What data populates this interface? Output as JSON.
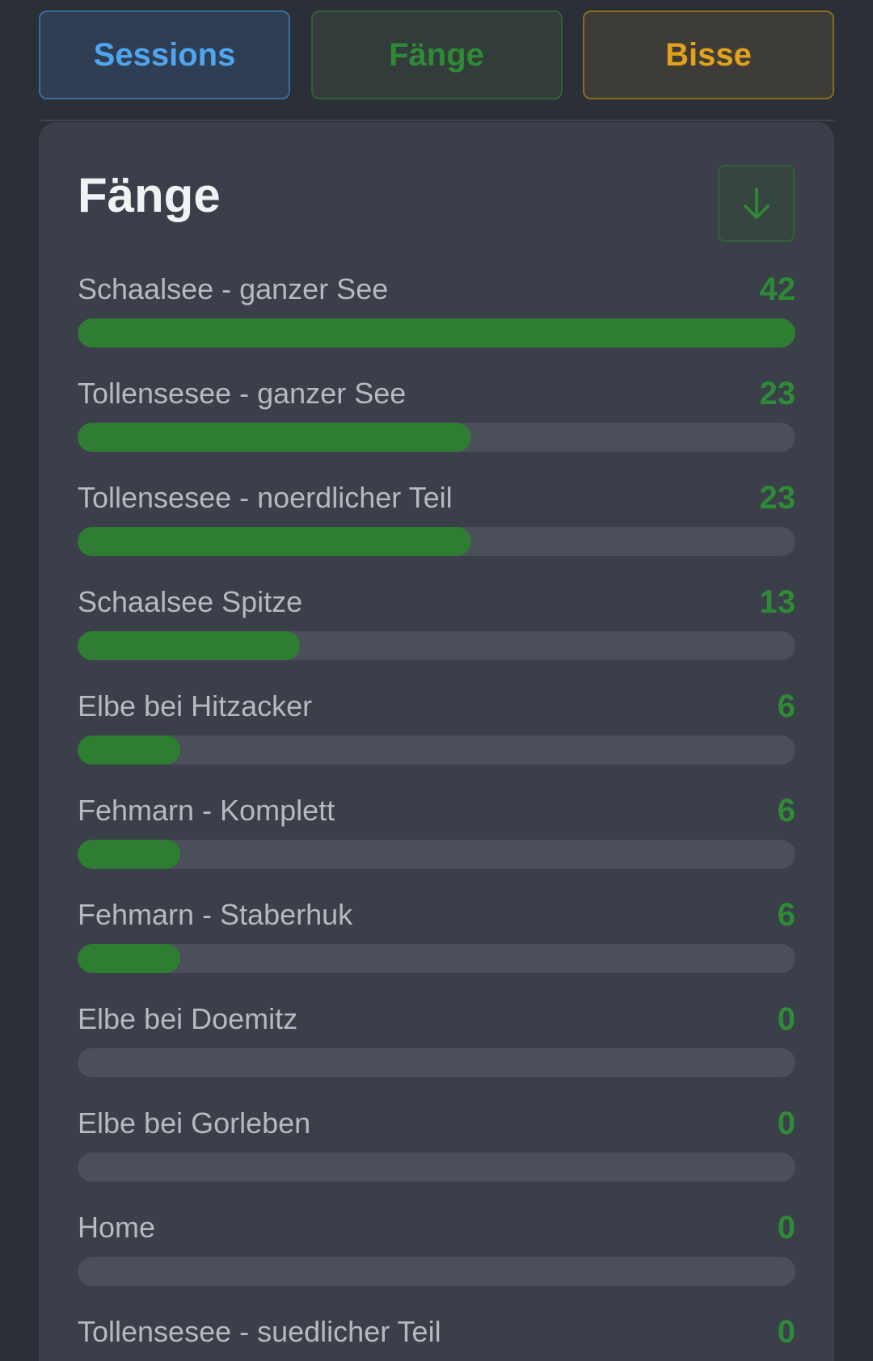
{
  "tabs": [
    {
      "label": "Sessions"
    },
    {
      "label": "Fänge"
    },
    {
      "label": "Bisse"
    }
  ],
  "card": {
    "title": "Fänge",
    "download_icon": "arrow-down-icon"
  },
  "colors": {
    "accent_green": "#2e8b35",
    "sessions_blue": "#4ea6f0",
    "bisse_yellow": "#e2a21b"
  },
  "rows": [
    {
      "label": "Schaalsee - ganzer See",
      "count": 42,
      "fraction": 1.0
    },
    {
      "label": "Tollensesee - ganzer See",
      "count": 23,
      "fraction": 0.548
    },
    {
      "label": "Tollensesee - noerdlicher Teil",
      "count": 23,
      "fraction": 0.548
    },
    {
      "label": "Schaalsee Spitze",
      "count": 13,
      "fraction": 0.31
    },
    {
      "label": "Elbe bei Hitzacker",
      "count": 6,
      "fraction": 0.143
    },
    {
      "label": "Fehmarn - Komplett",
      "count": 6,
      "fraction": 0.143
    },
    {
      "label": "Fehmarn - Staberhuk",
      "count": 6,
      "fraction": 0.143
    },
    {
      "label": "Elbe bei Doemitz",
      "count": 0,
      "fraction": 0
    },
    {
      "label": "Elbe bei Gorleben",
      "count": 0,
      "fraction": 0
    },
    {
      "label": "Home",
      "count": 0,
      "fraction": 0
    },
    {
      "label": "Tollensesee - suedlicher Teil",
      "count": 0,
      "fraction": 0
    }
  ]
}
